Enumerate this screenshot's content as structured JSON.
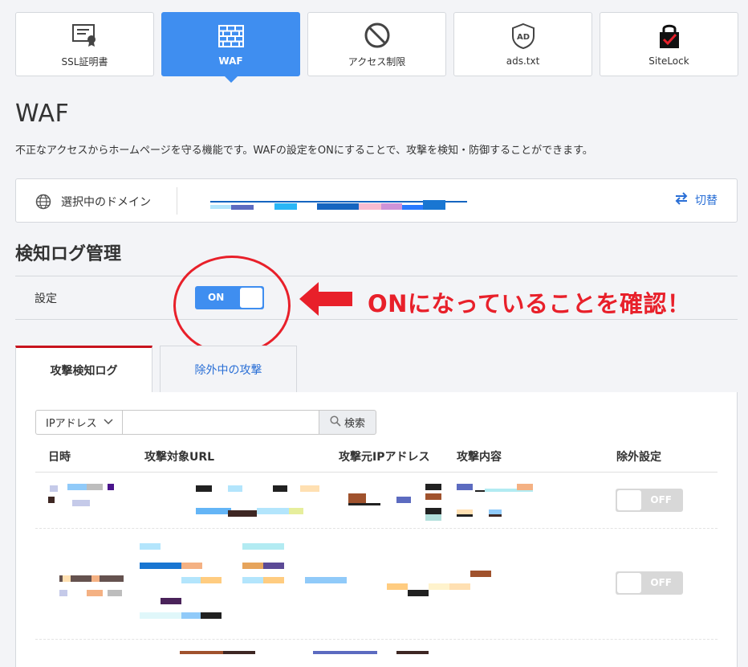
{
  "menu": [
    {
      "label": "SSL証明書",
      "icon": "certificate-icon",
      "active": false
    },
    {
      "label": "WAF",
      "icon": "firewall-icon",
      "active": true
    },
    {
      "label": "アクセス制限",
      "icon": "block-icon",
      "active": false
    },
    {
      "label": "ads.txt",
      "icon": "ad-shield-icon",
      "active": false
    },
    {
      "label": "SiteLock",
      "icon": "lock-check-icon",
      "active": false
    }
  ],
  "page": {
    "title": "WAF",
    "description": "不正なアクセスからホームページを守る機能です。WAFの設定をONにすることで、攻撃を検知・防御することができます。"
  },
  "domain": {
    "label": "選択中のドメイン",
    "switch_label": "切替"
  },
  "section": {
    "title": "検知ログ管理"
  },
  "setting": {
    "label": "設定",
    "toggle_label": "ON",
    "state": "on"
  },
  "annotation": {
    "text": "ONになっていることを確認！",
    "color": "#e8202a"
  },
  "log_tabs": [
    {
      "label": "攻撃検知ログ",
      "active": true
    },
    {
      "label": "除外中の攻撃",
      "active": false
    }
  ],
  "search": {
    "select_value": "IPアドレス",
    "input_value": "",
    "button_label": "検索"
  },
  "table": {
    "headers": [
      "日時",
      "攻撃対象URL",
      "攻撃元IPアドレス",
      "攻撃内容",
      "除外設定"
    ],
    "rows": [
      {
        "exclude_label": "OFF"
      },
      {
        "exclude_label": "OFF"
      }
    ]
  },
  "colors": {
    "accent": "#3f8ef0",
    "alert": "#e8202a",
    "tab_active_border": "#c8141e",
    "link": "#2a6fd6"
  }
}
